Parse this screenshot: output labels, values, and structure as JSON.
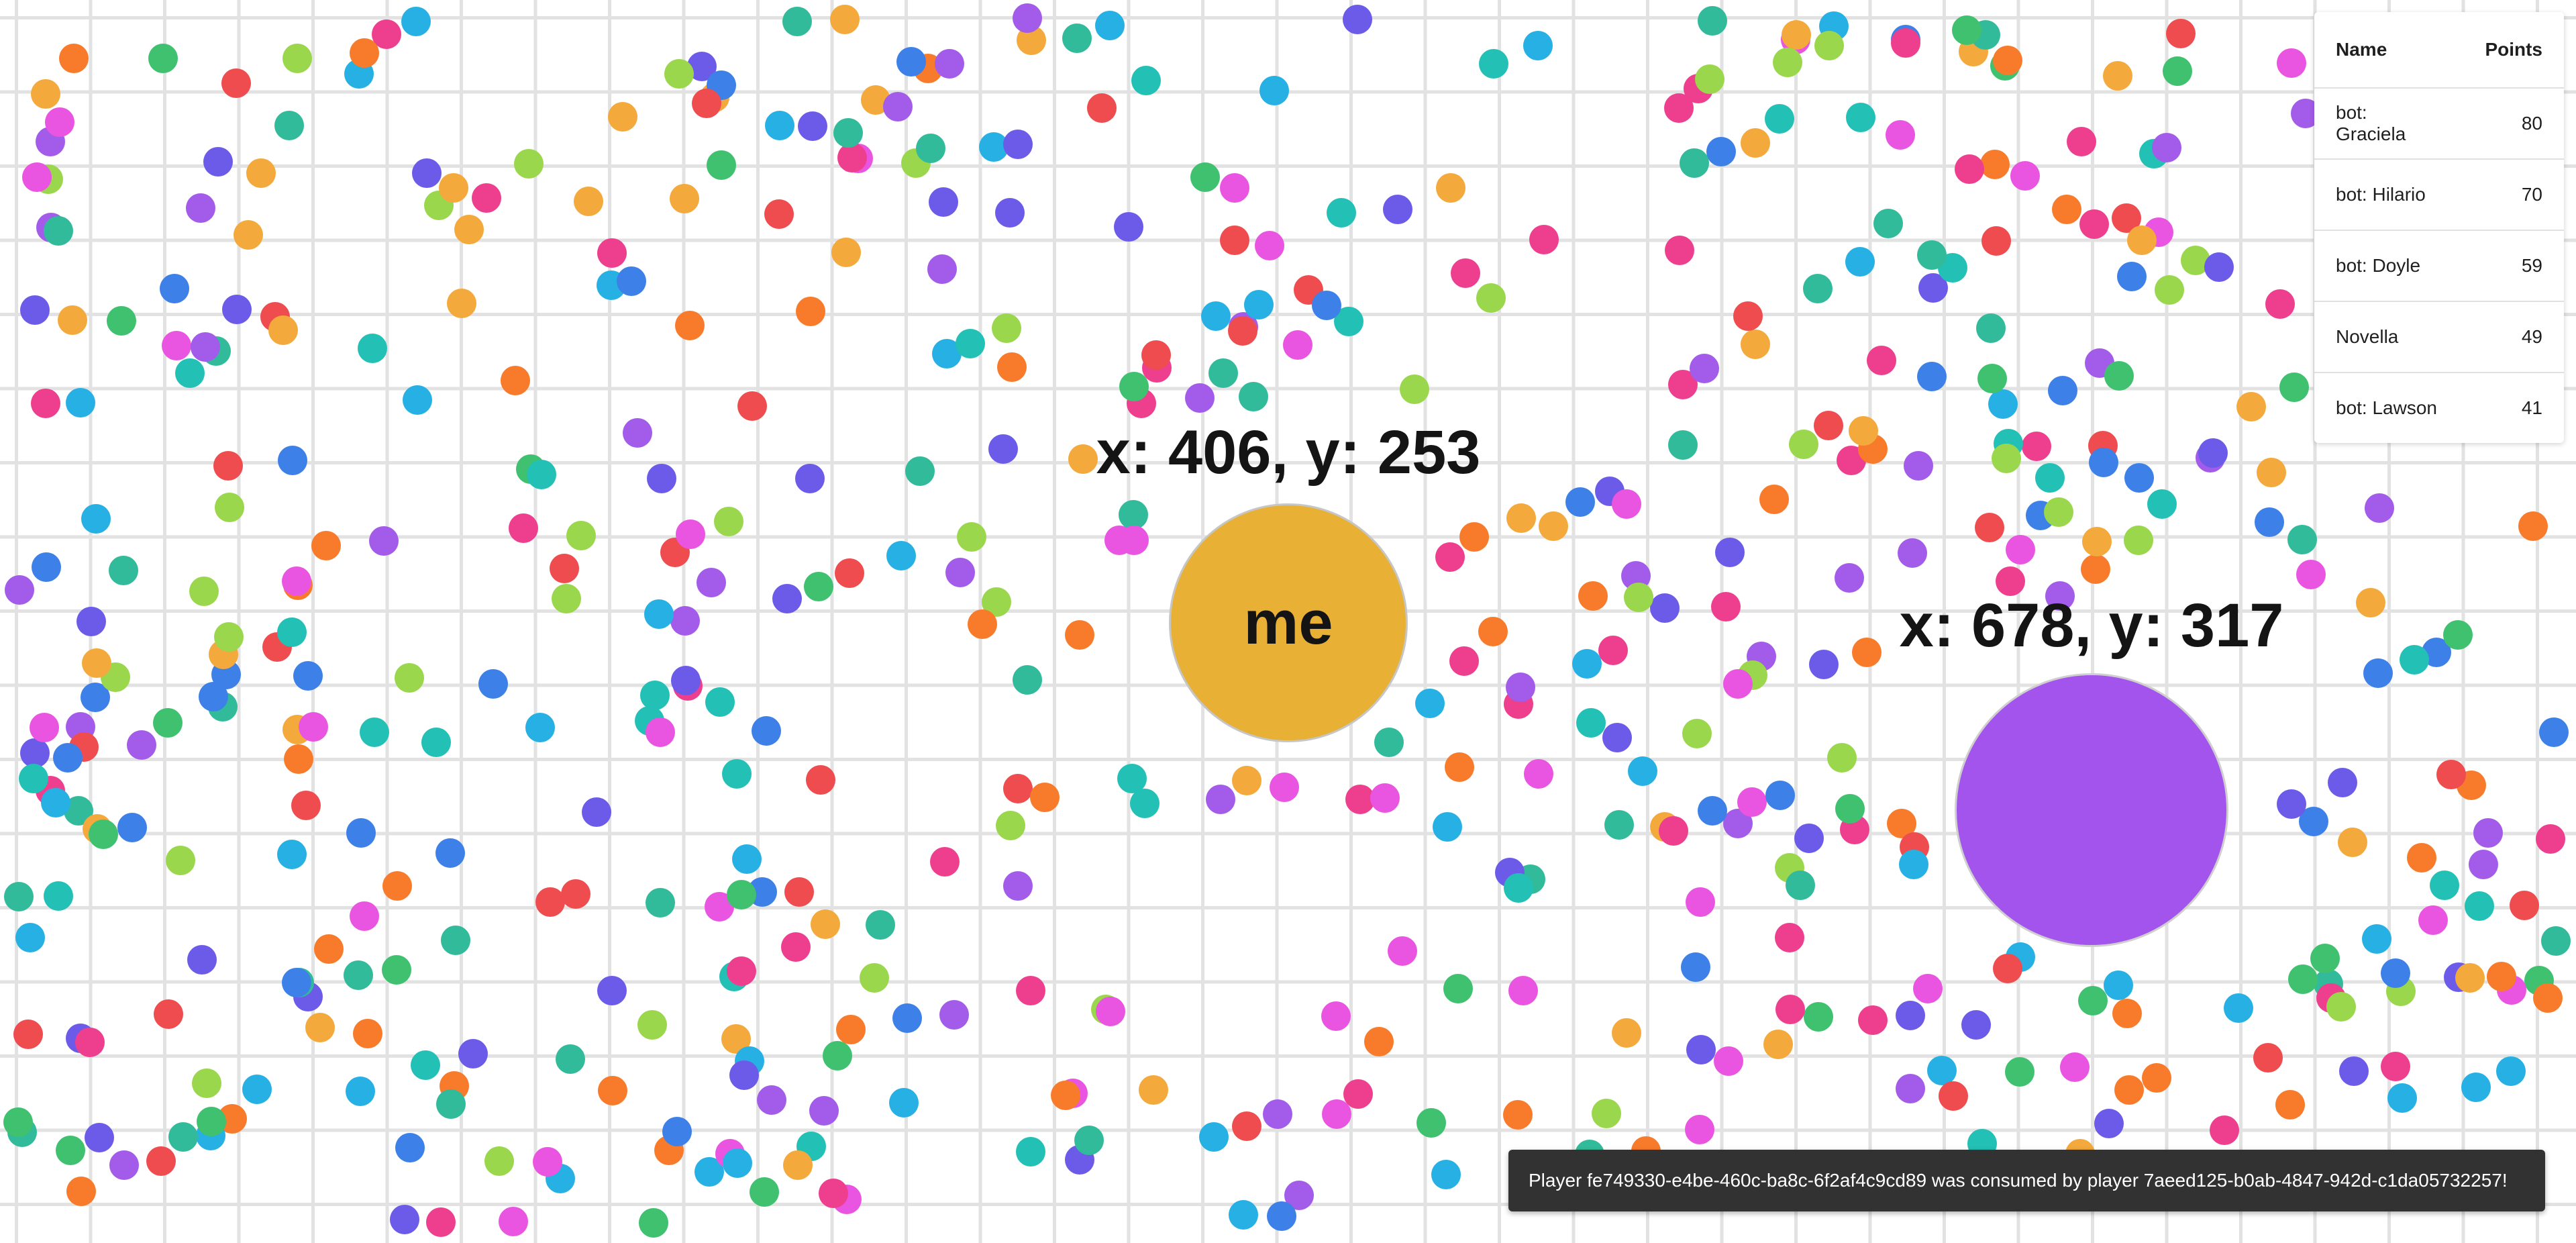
{
  "colors": {
    "grid_line": "#e2e2e2",
    "background": "#ffffff",
    "player_me": "#e8b034",
    "player_other": "#a354ec",
    "toast_bg": "#323232",
    "food_palette": [
      "#ee4c4f",
      "#f3a93b",
      "#9bd74c",
      "#32bb9a",
      "#27b0e3",
      "#6c5be8",
      "#a35be9",
      "#e955e1",
      "#ee3f8f",
      "#f87b2b",
      "#3fc16f",
      "#3d80e8",
      "#23c0b6"
    ]
  },
  "players": {
    "me": {
      "label": "me",
      "coords": "x: 406, y: 253"
    },
    "other": {
      "label": "",
      "coords": "x: 678, y: 317"
    }
  },
  "leaderboard": {
    "headers": {
      "name": "Name",
      "points": "Points"
    },
    "rows": [
      {
        "name": "bot: Graciela",
        "points": "80"
      },
      {
        "name": "bot: Hilario",
        "points": "70"
      },
      {
        "name": "bot: Doyle",
        "points": "59"
      },
      {
        "name": "Novella",
        "points": "49"
      },
      {
        "name": "bot: Lawson",
        "points": "41"
      }
    ]
  },
  "toast": {
    "message": "Player fe749330-e4be-460c-ba8c-6f2af4c9cd89 was consumed by player 7aeed125-b0ab-4847-942d-c1da05732257!"
  }
}
